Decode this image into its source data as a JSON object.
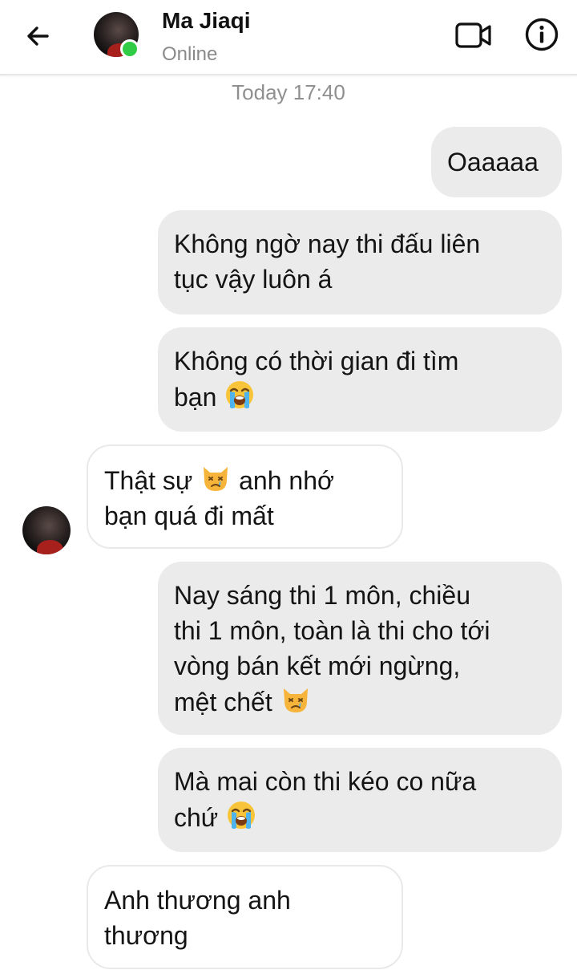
{
  "header": {
    "contact_name": "Ma Jiaqi",
    "status": "Online",
    "back_icon": "arrow-left-icon",
    "video_icon": "video-call-icon",
    "info_icon": "info-icon",
    "online_color": "#31cc46"
  },
  "chat": {
    "timestamp": "Today 17:40",
    "messages": [
      {
        "direction": "outgoing",
        "lines": [
          "Oaaaaa"
        ]
      },
      {
        "direction": "outgoing",
        "lines": [
          "Không ngờ nay thi đấu liên",
          "tục vậy luôn á"
        ]
      },
      {
        "direction": "outgoing",
        "lines": [
          "Không có thời gian đi tìm",
          "bạn"
        ],
        "emoji": "loudly-crying-face"
      },
      {
        "direction": "incoming",
        "part1": "Thật sự",
        "emoji": "crying-cat-face",
        "part2": "anh nhớ",
        "line2": "bạn quá đi mất"
      },
      {
        "direction": "outgoing",
        "lines": [
          "Nay sáng thi 1 môn, chiều",
          "thi 1 môn, toàn là thi cho tới",
          "vòng bán kết mới ngừng,",
          "mệt chết"
        ],
        "emoji": "crying-cat-face"
      },
      {
        "direction": "outgoing",
        "lines": [
          "Mà mai còn thi kéo co nữa",
          "chứ"
        ],
        "emoji": "loudly-crying-face"
      },
      {
        "direction": "incoming",
        "lines": [
          "Anh thương anh",
          "thương"
        ]
      }
    ]
  },
  "colors": {
    "outgoing_bubble": "#ebebeb",
    "incoming_bubble_border": "#e9e9e9",
    "timestamp_text": "#8f8f8f"
  }
}
